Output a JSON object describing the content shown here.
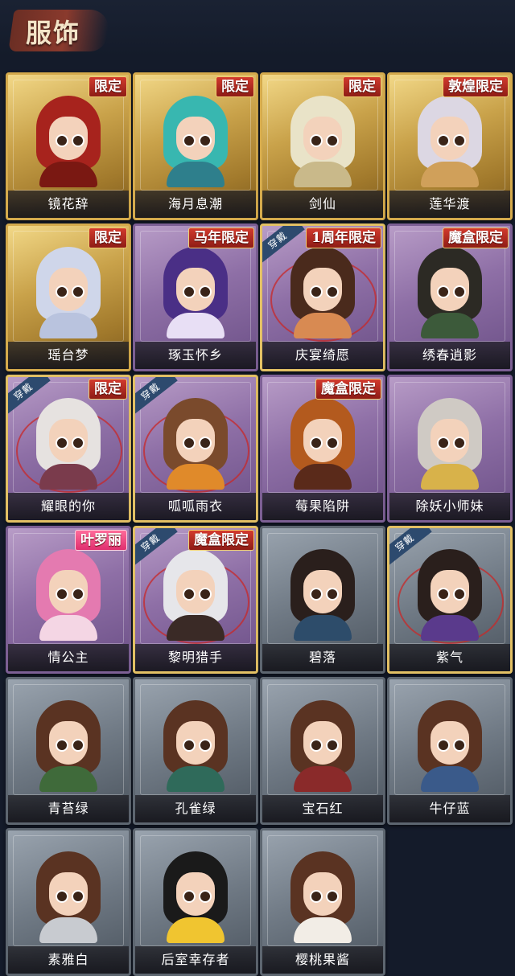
{
  "header": {
    "title": "服饰"
  },
  "cards": [
    {
      "name": "镜花辞",
      "rarity": "gold",
      "tag": "限定",
      "equipped": false,
      "hair": "#a7231d",
      "outfit": "#7a1812"
    },
    {
      "name": "海月息潮",
      "rarity": "gold",
      "tag": "限定",
      "equipped": false,
      "hair": "#38b7b0",
      "outfit": "#2e7f8c"
    },
    {
      "name": "剑仙",
      "rarity": "gold",
      "tag": "限定",
      "equipped": false,
      "hair": "#e9e3c8",
      "outfit": "#c9b98a"
    },
    {
      "name": "莲华渡",
      "rarity": "gold",
      "tag": "敦煌限定",
      "equipped": false,
      "hair": "#dcd7e3",
      "outfit": "#d0a05a"
    },
    {
      "name": "瑶台梦",
      "rarity": "gold",
      "tag": "限定",
      "equipped": false,
      "hair": "#cfd6ea",
      "outfit": "#b9c3de"
    },
    {
      "name": "琢玉怀乡",
      "rarity": "purple",
      "tag": "马年限定",
      "equipped": false,
      "hair": "#4a2f86",
      "outfit": "#e8dff5"
    },
    {
      "name": "庆宴绮愿",
      "rarity": "purple",
      "tag": "1周年限定",
      "equipped": true,
      "hair": "#4a2a1c",
      "outfit": "#d88a52"
    },
    {
      "name": "绣春逍影",
      "rarity": "purple",
      "tag": "魔盒限定",
      "equipped": false,
      "hair": "#2c2a24",
      "outfit": "#3c5a3a"
    },
    {
      "name": "耀眼的你",
      "rarity": "purple",
      "tag": "限定",
      "equipped": true,
      "hair": "#e6e2e0",
      "outfit": "#7a3b4c"
    },
    {
      "name": "呱呱雨衣",
      "rarity": "purple",
      "tag": "",
      "equipped": true,
      "hair": "#7a4a2c",
      "outfit": "#e08a2a"
    },
    {
      "name": "莓果陷阱",
      "rarity": "purple",
      "tag": "魔盒限定",
      "equipped": false,
      "hair": "#b35a1e",
      "outfit": "#5a2a1a"
    },
    {
      "name": "除妖小师妹",
      "rarity": "purple",
      "tag": "",
      "equipped": false,
      "hair": "#cfcac4",
      "outfit": "#d8b24a"
    },
    {
      "name": "情公主",
      "rarity": "purple",
      "tag": "叶罗丽",
      "equipped": false,
      "hair": "#e47ab0",
      "outfit": "#f4d6e4"
    },
    {
      "name": "黎明猎手",
      "rarity": "purple",
      "tag": "魔盒限定",
      "equipped": true,
      "hair": "#e6e6ea",
      "outfit": "#3a2a26"
    },
    {
      "name": "碧落",
      "rarity": "gray",
      "tag": "",
      "equipped": false,
      "hair": "#2a1f1c",
      "outfit": "#2d4c6a"
    },
    {
      "name": "紫气",
      "rarity": "gray",
      "tag": "",
      "equipped": true,
      "hair": "#2a1f1c",
      "outfit": "#5a3a8c"
    },
    {
      "name": "青苔绿",
      "rarity": "gray",
      "tag": "",
      "equipped": false,
      "hair": "#5a3322",
      "outfit": "#3f6a3a"
    },
    {
      "name": "孔雀绿",
      "rarity": "gray",
      "tag": "",
      "equipped": false,
      "hair": "#5a3322",
      "outfit": "#2f6a5a"
    },
    {
      "name": "宝石红",
      "rarity": "gray",
      "tag": "",
      "equipped": false,
      "hair": "#5a3322",
      "outfit": "#8a2a2a"
    },
    {
      "name": "牛仔蓝",
      "rarity": "gray",
      "tag": "",
      "equipped": false,
      "hair": "#5a3322",
      "outfit": "#3a5a8a"
    },
    {
      "name": "素雅白",
      "rarity": "gray",
      "tag": "",
      "equipped": false,
      "hair": "#5a3322",
      "outfit": "#c8cbd0"
    },
    {
      "name": "后室幸存者",
      "rarity": "gray",
      "tag": "",
      "equipped": false,
      "hair": "#1a1a1a",
      "outfit": "#f0c530"
    },
    {
      "name": "樱桃果酱",
      "rarity": "gray",
      "tag": "",
      "equipped": false,
      "hair": "#5a3322",
      "outfit": "#f2ede6"
    }
  ],
  "equip_label": "穿戴"
}
